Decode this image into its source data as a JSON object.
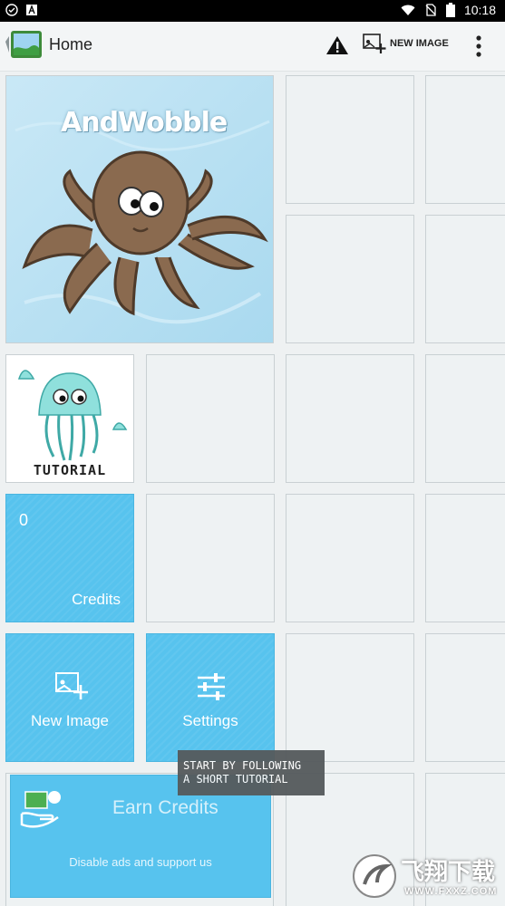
{
  "status_bar": {
    "time": "10:18"
  },
  "app_bar": {
    "title": "Home",
    "new_image_label": "NEW IMAGE"
  },
  "tiles": {
    "featured_logo": "AndWobble",
    "tutorial_label": "TUTORIAL",
    "credits_count": "0",
    "credits_label": "Credits",
    "new_image_label": "New Image",
    "settings_label": "Settings"
  },
  "earn_credits": {
    "title": "Earn Credits",
    "subtitle": "Disable ads and support us"
  },
  "tooltip": {
    "line1": "START BY FOLLOWING",
    "line2": "A SHORT TUTORIAL"
  },
  "watermark": {
    "text": "飞翔下载",
    "url": "WWW.FXXZ.COM"
  },
  "colors": {
    "accent": "#57c3ee",
    "tile_border": "#c9d0d3",
    "background": "#eef1f2"
  }
}
